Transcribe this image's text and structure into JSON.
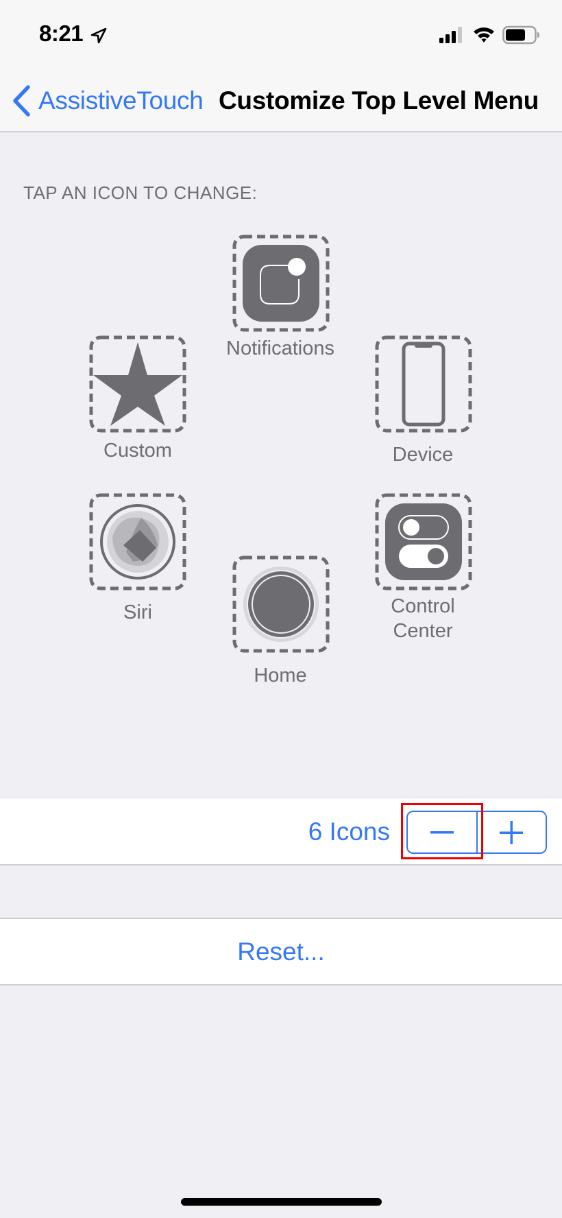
{
  "status_bar": {
    "time": "8:21",
    "icons": [
      "location-arrow-icon",
      "cellular-signal-icon",
      "wifi-icon",
      "battery-icon"
    ]
  },
  "nav": {
    "back_label": "AssistiveTouch",
    "title": "Customize Top Level Menu"
  },
  "section_header": "TAP AN ICON TO CHANGE:",
  "menu_icons": [
    {
      "label": "Notifications",
      "icon": "notifications-icon"
    },
    {
      "label": "Custom",
      "icon": "star-icon"
    },
    {
      "label": "Device",
      "icon": "device-iphone-icon"
    },
    {
      "label": "Siri",
      "icon": "siri-icon"
    },
    {
      "label": "Home",
      "icon": "home-button-icon"
    },
    {
      "label": "Control",
      "label2": "Center",
      "icon": "control-center-icon"
    }
  ],
  "stepper": {
    "count_label": "6 Icons",
    "count": 6,
    "decrement_symbol": "−",
    "increment_symbol": "+"
  },
  "reset_label": "Reset...",
  "colors": {
    "accent": "#3478f6",
    "icon_gray": "#6d6c71",
    "background": "#efeff4",
    "highlight": "#f20000"
  }
}
